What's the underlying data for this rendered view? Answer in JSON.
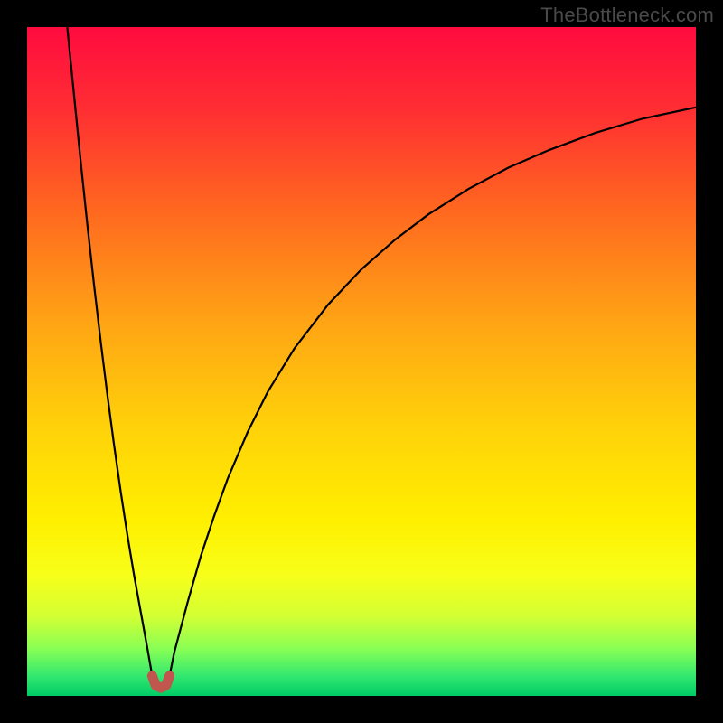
{
  "watermark": "TheBottleneck.com",
  "chart_data": {
    "type": "line",
    "title": "",
    "xlabel": "",
    "ylabel": "",
    "xlim": [
      0,
      100
    ],
    "ylim": [
      0,
      100
    ],
    "grid": false,
    "legend": false,
    "gradient_stops": [
      {
        "offset": 0.0,
        "color": "#ff0b3f"
      },
      {
        "offset": 0.12,
        "color": "#ff2d33"
      },
      {
        "offset": 0.28,
        "color": "#ff6a1f"
      },
      {
        "offset": 0.45,
        "color": "#ffa714"
      },
      {
        "offset": 0.6,
        "color": "#ffd209"
      },
      {
        "offset": 0.74,
        "color": "#fff000"
      },
      {
        "offset": 0.82,
        "color": "#f7ff1a"
      },
      {
        "offset": 0.88,
        "color": "#d4ff33"
      },
      {
        "offset": 0.93,
        "color": "#88ff55"
      },
      {
        "offset": 0.97,
        "color": "#33e86f"
      },
      {
        "offset": 1.0,
        "color": "#00cc66"
      }
    ],
    "series": [
      {
        "name": "bottleneck-left",
        "stroke": "#000000",
        "stroke_width": 2.2,
        "x": [
          6.0,
          7.0,
          8.0,
          9.0,
          10.0,
          11.0,
          12.0,
          13.0,
          14.0,
          15.0,
          16.0,
          17.0,
          18.0,
          18.7
        ],
        "y": [
          100.0,
          90.0,
          80.0,
          70.5,
          61.5,
          53.0,
          45.0,
          37.5,
          30.5,
          24.0,
          18.0,
          12.5,
          7.0,
          3.0
        ]
      },
      {
        "name": "bottleneck-right",
        "stroke": "#000000",
        "stroke_width": 2.2,
        "x": [
          21.3,
          22.0,
          24.0,
          26.0,
          28.0,
          30.0,
          33.0,
          36.0,
          40.0,
          45.0,
          50.0,
          55.0,
          60.0,
          66.0,
          72.0,
          78.0,
          85.0,
          92.0,
          100.0
        ],
        "y": [
          3.0,
          6.5,
          14.0,
          21.0,
          27.0,
          32.5,
          39.5,
          45.5,
          52.0,
          58.5,
          63.8,
          68.2,
          72.0,
          75.8,
          79.0,
          81.6,
          84.2,
          86.3,
          88.0
        ]
      },
      {
        "name": "minimum-marker",
        "stroke": "#c1564e",
        "stroke_width": 11,
        "linecap": "round",
        "x": [
          18.7,
          19.2,
          20.0,
          20.8,
          21.3
        ],
        "y": [
          3.0,
          1.6,
          1.2,
          1.6,
          3.0
        ]
      }
    ],
    "annotations": []
  }
}
